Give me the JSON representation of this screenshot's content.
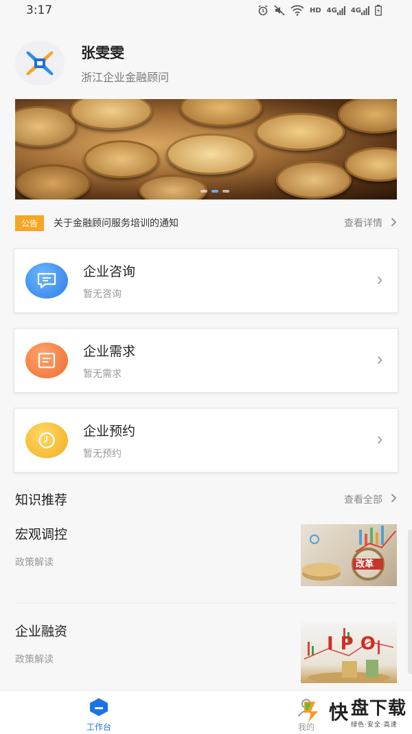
{
  "status": {
    "time": "3:17",
    "hd": "HD",
    "net1": "4G",
    "net2": "4G"
  },
  "profile": {
    "name": "张雯雯",
    "role": "浙江企业金融顾问"
  },
  "notice": {
    "tag": "公告",
    "text": "关于金融顾问服务培训的通知",
    "more": "查看详情"
  },
  "cards": [
    {
      "title": "企业咨询",
      "sub": "暂无咨询",
      "color": "#3d8ff0"
    },
    {
      "title": "企业需求",
      "sub": "暂无需求",
      "color": "#f27b3e"
    },
    {
      "title": "企业预约",
      "sub": "暂无预约",
      "color": "#f5b82a"
    }
  ],
  "knowledge": {
    "title": "知识推荐",
    "more": "查看全部",
    "articles": [
      {
        "title": "宏观调控",
        "category": "政策解读",
        "thumb_text": "改革"
      },
      {
        "title": "企业融资",
        "category": "政策解读",
        "thumb_text": "IPO"
      }
    ]
  },
  "tabs": [
    {
      "label": "工作台",
      "active": true
    },
    {
      "label": "我的",
      "active": false
    }
  ],
  "watermark": {
    "brand": "快",
    "main": "盘下载",
    "slogan": "绿色·安全·高速"
  },
  "colors": {
    "accent": "#1a73e8",
    "notice": "#f5a623"
  }
}
